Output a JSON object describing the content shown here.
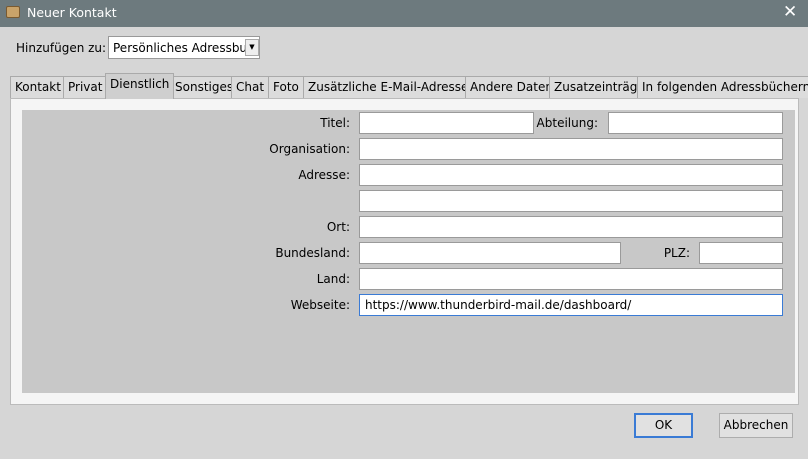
{
  "window": {
    "title": "Neuer Kontakt",
    "close_icon": "close-icon",
    "app_icon": "address-book-icon"
  },
  "add_to": {
    "label": "Hinzufügen zu:",
    "value": "Persönliches Adressbu..."
  },
  "tabs": [
    {
      "label": "Kontakt"
    },
    {
      "label": "Privat"
    },
    {
      "label": "Dienstlich",
      "active": true
    },
    {
      "label": "Sonstiges"
    },
    {
      "label": "Chat"
    },
    {
      "label": "Foto"
    },
    {
      "label": "Zusätzliche E-Mail-Adressen"
    },
    {
      "label": "Andere Daten"
    },
    {
      "label": "Zusatzeinträge"
    },
    {
      "label": "In folgenden Adressbüchern"
    }
  ],
  "form": {
    "titel": {
      "label": "Titel:",
      "value": ""
    },
    "abteilung": {
      "label": "Abteilung:",
      "value": ""
    },
    "organisation": {
      "label": "Organisation:",
      "value": ""
    },
    "adresse": {
      "label": "Adresse:",
      "value": "",
      "value2": ""
    },
    "ort": {
      "label": "Ort:",
      "value": ""
    },
    "bundesland": {
      "label": "Bundesland:",
      "value": ""
    },
    "plz": {
      "label": "PLZ:",
      "value": ""
    },
    "land": {
      "label": "Land:",
      "value": ""
    },
    "webseite": {
      "label": "Webseite:",
      "value": "https://www.thunderbird-mail.de/dashboard/"
    }
  },
  "buttons": {
    "ok": "OK",
    "cancel": "Abbrechen"
  }
}
